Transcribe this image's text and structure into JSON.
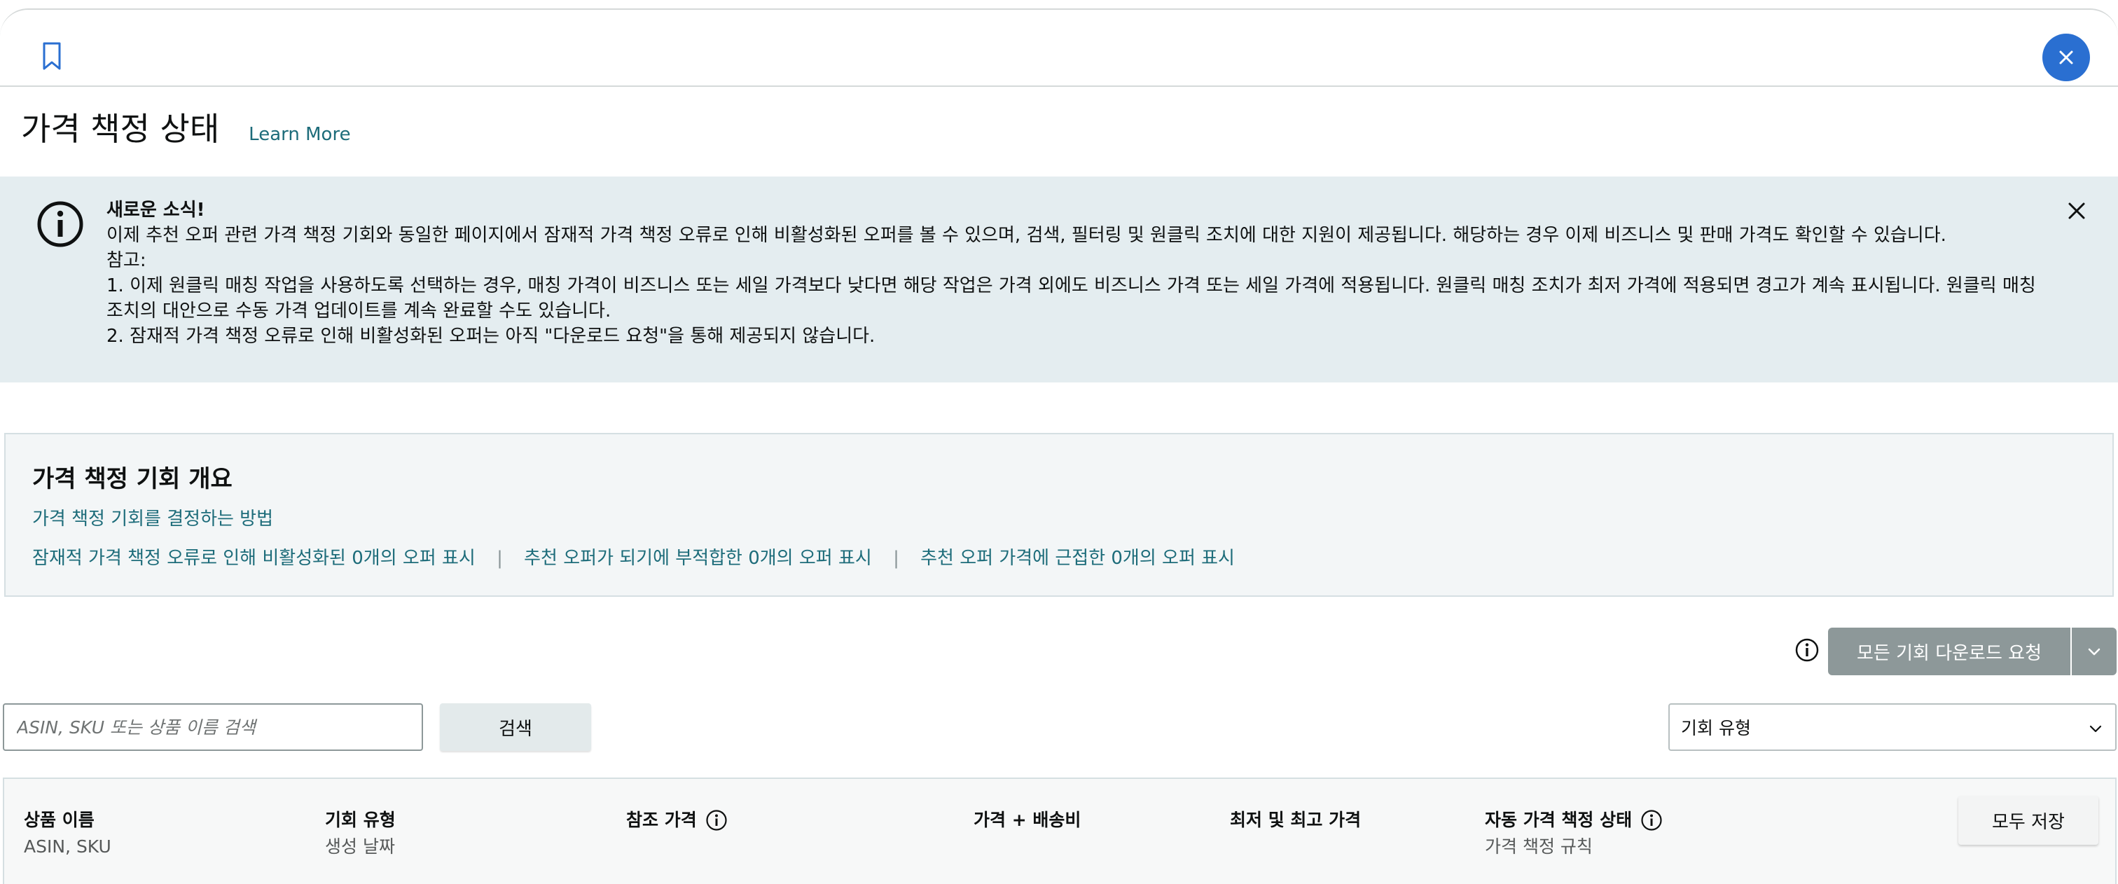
{
  "header": {
    "bookmark_icon": "bookmark-icon",
    "close_icon": "close-icon",
    "accent_color": "#2a6fd1"
  },
  "page": {
    "title": "가격 책정 상태",
    "learn_more": "Learn More"
  },
  "banner": {
    "icon": "info-circle-icon",
    "heading": "새로운 소식!",
    "line1": "이제 추천 오퍼 관련 가격 책정 기회와 동일한 페이지에서 잠재적 가격 책정 오류로 인해 비활성화된 오퍼를 볼 수 있으며, 검색, 필터링 및 원클릭 조치에 대한 지원이 제공됩니다. 해당하는 경우 이제 비즈니스 및 판매 가격도 확인할 수 있습니다.",
    "note_label": "참고:",
    "note1": "1. 이제 원클릭 매칭 작업을 사용하도록 선택하는 경우, 매칭 가격이 비즈니스 또는 세일 가격보다 낮다면 해당 작업은 가격 외에도 비즈니스 가격 또는 세일 가격에 적용됩니다. 원클릭 매칭 조치가 최저 가격에 적용되면 경고가 계속 표시됩니다. 원클릭 매칭 조치의 대안으로 수동 가격 업데이트를 계속 완료할 수도 있습니다.",
    "note2": "2. 잠재적 가격 책정 오류로 인해 비활성화된 오퍼는 아직 \"다운로드 요청\"을 통해 제공되지 않습니다.",
    "close_icon": "close-icon",
    "background": "#e4edf0"
  },
  "overview": {
    "title": "가격 책정 기회 개요",
    "how_link": "가격 책정 기회를 결정하는 방법",
    "filter1": "잠재적 가격 책정 오류로 인해 비활성화된 0개의 오퍼 표시",
    "filter2": "추천 오퍼가 되기에 부적합한 0개의 오퍼 표시",
    "filter3": "추천 오퍼 가격에 근접한 0개의 오퍼 표시",
    "separator": "|"
  },
  "download": {
    "label": "모든 기회 다운로드 요청",
    "info_icon": "info-circle-icon",
    "toggle_icon": "chevron-down-icon"
  },
  "search": {
    "placeholder": "ASIN, SKU 또는 상품 이름 검색",
    "button": "검색"
  },
  "filter_select": {
    "value": "기회 유형",
    "icon": "chevron-down-icon"
  },
  "table": {
    "columns": [
      {
        "main": "상품 이름",
        "sub": "ASIN, SKU"
      },
      {
        "main": "기회 유형",
        "sub": "생성 날짜"
      },
      {
        "main": "참조 가격",
        "sub": ""
      },
      {
        "main": "가격 + 배송비",
        "sub": ""
      },
      {
        "main": "최저 및 최고 가격",
        "sub": ""
      },
      {
        "main": "자동 가격 책정 상태",
        "sub": "가격 책정 규칙"
      }
    ],
    "save_all": "모두 저장"
  }
}
